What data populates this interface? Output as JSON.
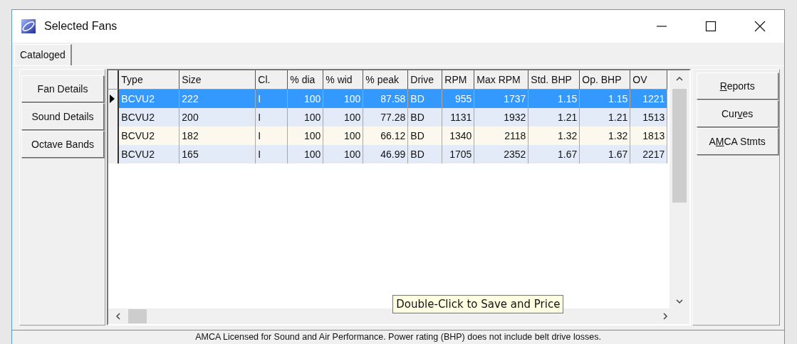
{
  "window": {
    "title": "Selected Fans"
  },
  "tabs": [
    {
      "label": "Cataloged",
      "selected": true
    }
  ],
  "left_buttons": [
    "Fan Details",
    "Sound Details",
    "Octave Bands"
  ],
  "table": {
    "columns": [
      "Type",
      "Size",
      "Cl.",
      "% dia",
      "% wid",
      "% peak",
      "Drive",
      "RPM",
      "Max RPM",
      "Std. BHP",
      "Op. BHP",
      "OV"
    ],
    "rows": [
      {
        "selected": true,
        "cells": [
          "BCVU2",
          "222",
          "I",
          "100",
          "100",
          "87.58",
          "BD",
          "955",
          "1737",
          "1.15",
          "1.15",
          "1221"
        ]
      },
      {
        "selected": false,
        "cells": [
          "BCVU2",
          "200",
          "I",
          "100",
          "100",
          "77.28",
          "BD",
          "1131",
          "1932",
          "1.21",
          "1.21",
          "1513"
        ]
      },
      {
        "selected": false,
        "cells": [
          "BCVU2",
          "182",
          "I",
          "100",
          "100",
          "66.12",
          "BD",
          "1340",
          "2118",
          "1.32",
          "1.32",
          "1813"
        ]
      },
      {
        "selected": false,
        "cells": [
          "BCVU2",
          "165",
          "I",
          "100",
          "100",
          "46.99",
          "BD",
          "1705",
          "2352",
          "1.67",
          "1.67",
          "2217"
        ]
      }
    ]
  },
  "tooltip": "Double-Click to Save and Price",
  "right_buttons": [
    {
      "key": "R",
      "after": "eports"
    },
    {
      "before": "Cur",
      "key": "v",
      "after": "es"
    },
    {
      "before": "A",
      "key": "M",
      "after": "CA Stmts"
    }
  ],
  "status_bar": "AMCA Licensed for Sound and Air Performance.  Power rating (BHP) does not include belt drive losses."
}
